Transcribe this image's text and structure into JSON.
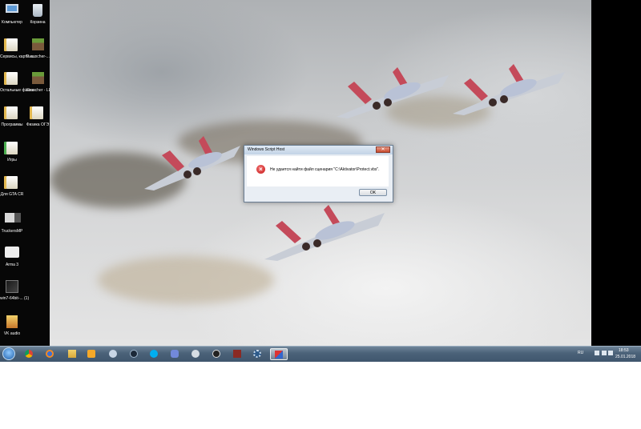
{
  "desktop": {
    "icons": [
      {
        "label": "Компьютер"
      },
      {
        "label": "Корзина"
      },
      {
        "label": "Сервисы, картинк..."
      },
      {
        "label": "TLauncher-..."
      },
      {
        "label": "Остальные файлы"
      },
      {
        "label": "Xauncher - LEGACY"
      },
      {
        "label": "Программы"
      },
      {
        "label": "Физика ОГЭ"
      },
      {
        "label": "Игры"
      },
      {
        "label": "Для GTA CR"
      },
      {
        "label": "TruckersMP"
      },
      {
        "label": "Arma 3"
      },
      {
        "label": "win7-64bit-... (1)"
      },
      {
        "label": "VK audio"
      }
    ]
  },
  "dialog": {
    "title": "Windows Script Host",
    "close_label": "✕",
    "error_icon": "error-x-icon",
    "message": "Не удается найти файл сценария \"C:\\Aktivator\\Protect.vbs\".",
    "ok_label": "OK"
  },
  "taskbar": {
    "pinned": [
      "chrome-icon",
      "firefox-icon",
      "explorer-icon",
      "media-player-icon",
      "app-icon",
      "steam-icon",
      "skype-icon",
      "discord-icon",
      "app2-icon",
      "unity-icon",
      "app3-icon",
      "settings-icon",
      "script-host-icon"
    ],
    "tray": {
      "language": "RU",
      "time": "18:53",
      "date": "25.01.2018"
    }
  },
  "colors": {
    "taskbar": "#4a6178",
    "dialog_bg": "#e9eef4",
    "close_red": "#c7492c"
  }
}
